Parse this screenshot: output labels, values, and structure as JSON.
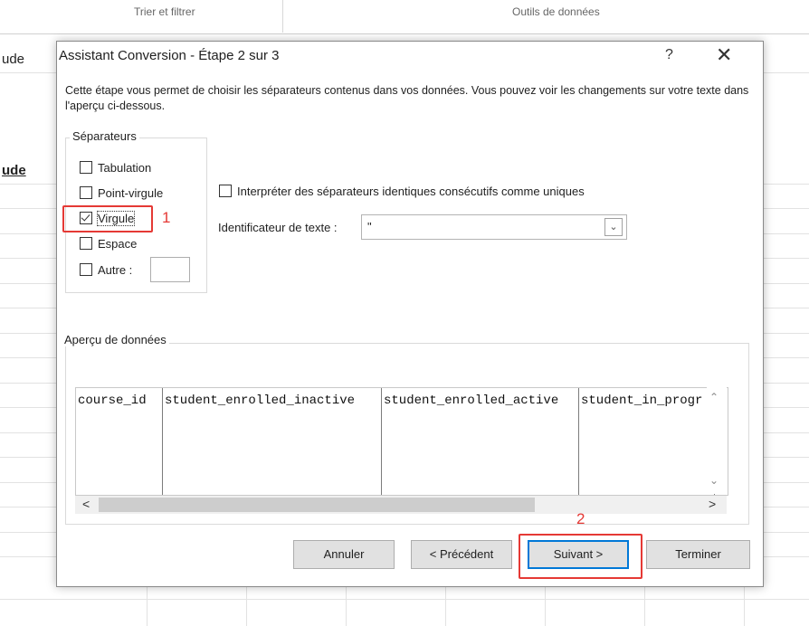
{
  "background": {
    "ribbon_group_left": "Trier et filtrer",
    "ribbon_group_right": "Outils de données",
    "cell_text_1": "ude",
    "cell_text_2": "ude"
  },
  "dialog": {
    "title": "Assistant Conversion - Étape 2 sur 3",
    "help_label": "?",
    "close_label": "✕",
    "description": "Cette étape vous permet de choisir les séparateurs contenus dans vos données. Vous pouvez voir les changements sur votre texte dans l'aperçu ci-dessous.",
    "separators": {
      "legend": "Séparateurs",
      "tab": {
        "label": "Tabulation",
        "checked": false
      },
      "semicolon": {
        "label": "Point-virgule",
        "checked": false
      },
      "comma": {
        "label": "Virgule",
        "checked": true
      },
      "space": {
        "label": "Espace",
        "checked": false
      },
      "other": {
        "label": "Autre :",
        "checked": false,
        "value": ""
      }
    },
    "consecutive": {
      "label": "Interpréter des séparateurs identiques consécutifs comme uniques",
      "checked": false
    },
    "text_qualifier": {
      "label": "Identificateur de texte :",
      "value": "\""
    },
    "preview": {
      "legend": "Aperçu de données",
      "columns": [
        "course_id",
        "student_enrolled_inactive",
        "student_enrolled_active",
        "student_in_progr"
      ]
    },
    "buttons": {
      "cancel": "Annuler",
      "previous": "< Précédent",
      "next": "Suivant >",
      "finish": "Terminer"
    },
    "annotations": {
      "first": "1",
      "second": "2"
    }
  },
  "colors": {
    "annotation": "#e53935",
    "focus": "#0078d7"
  }
}
